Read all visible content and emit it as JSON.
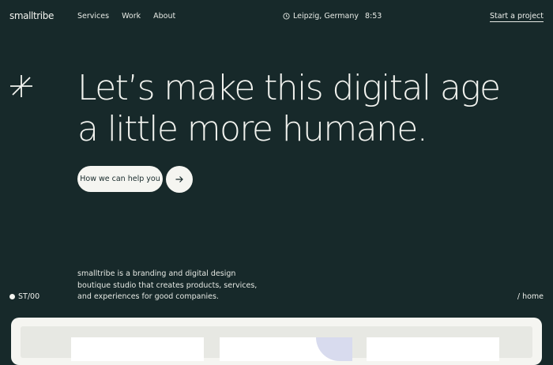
{
  "brand": {
    "logo": "smalltribe"
  },
  "nav": {
    "links": [
      "Services",
      "Work",
      "About"
    ],
    "location": "Leipzig, Germany",
    "time": "8:53",
    "cta": "Start a project"
  },
  "hero": {
    "line1": "Let’s make this digital age",
    "line2": "a little more humane.",
    "button_label": "How we can help you"
  },
  "about": {
    "description": "smalltribe is a branding and digital design boutique studio that creates products, services, and experiences for good companies."
  },
  "footer_labels": {
    "section": "ST/00",
    "path": "/ home"
  },
  "icons": {
    "location": "clock-icon",
    "hero_mark": "asterisk-icon",
    "arrow": "arrow-right-icon"
  },
  "colors": {
    "background": "#17292a",
    "text": "#eef0ec",
    "button": "#f5f5f1"
  }
}
